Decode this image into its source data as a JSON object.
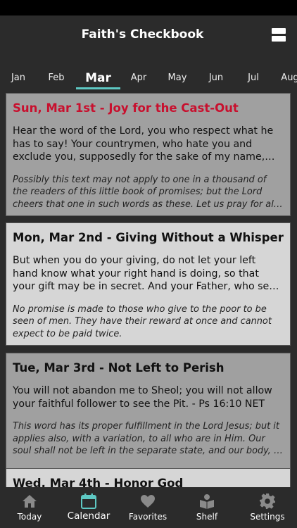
{
  "header": {
    "title": "Faith's Checkbook"
  },
  "months": [
    {
      "label": "Jan",
      "active": false
    },
    {
      "label": "Feb",
      "active": false
    },
    {
      "label": "Mar",
      "active": true
    },
    {
      "label": "Apr",
      "active": false
    },
    {
      "label": "May",
      "active": false
    },
    {
      "label": "Jun",
      "active": false
    },
    {
      "label": "Jul",
      "active": false
    },
    {
      "label": "Aug",
      "active": false
    }
  ],
  "colors": {
    "accent": "#5ec8c3",
    "title_red": "#c8102e"
  },
  "entries": [
    {
      "title": "Sun, Mar 1st - Joy for the Cast-Out",
      "body": "Hear the word of the Lord, you who respect what he has to say! Your countrymen, who hate you and exclude you, supposedly for the sake of my name, say, “May t…",
      "note": "Possibly this text may not apply to one in a thousand of the readers of this little book of promises; but the Lord cheers that one in such words as these. Let us pray for all such a…"
    },
    {
      "title": "Mon, Mar 2nd - Giving Without a Whisper",
      "body": "But when you do your giving, do not let your left hand know what your right hand is doing, so that your gift may be in secret. And your Father, who sees in secret,…",
      "note": "No promise is made to those who give to the poor to be seen of men. They have their reward at once and cannot expect to be paid twice."
    },
    {
      "title": "Tue, Mar 3rd - Not Left to Perish",
      "body": "You will not abandon me to Sheol; you will not allow your faithful follower to see the Pit. - Ps 16:10 NET",
      "note": "This word has its proper fulfillment in the Lord Jesus; but it applies also, with a variation, to all who are in Him. Our soul shall not be left in the separate state, and our body, …"
    },
    {
      "title": "Wed, Mar 4th - Honor God"
    }
  ],
  "tabs": [
    {
      "label": "Today",
      "icon": "home-icon"
    },
    {
      "label": "Calendar",
      "icon": "calendar-icon",
      "active": true
    },
    {
      "label": "Favorites",
      "icon": "heart-icon"
    },
    {
      "label": "Shelf",
      "icon": "book-reader-icon"
    },
    {
      "label": "Settings",
      "icon": "gear-icon"
    }
  ]
}
